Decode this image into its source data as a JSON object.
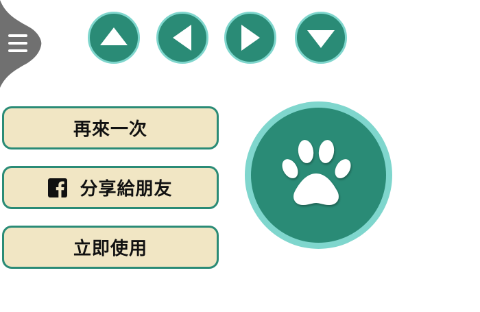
{
  "menu": {
    "icon": "hamburger-icon"
  },
  "nav": {
    "up": {
      "icon": "arrow-up-icon"
    },
    "left": {
      "icon": "arrow-left-icon"
    },
    "right": {
      "icon": "arrow-right-icon"
    },
    "down": {
      "icon": "arrow-down-icon"
    }
  },
  "actions": {
    "retry_label": "再來一次",
    "share_label": "分享給朋友",
    "share_icon": "facebook-icon",
    "use_label": "立即使用"
  },
  "paw": {
    "icon": "paw-icon"
  },
  "colors": {
    "primary": "#2a8b76",
    "ring": "#7fd6cd",
    "button_bg": "#f1e6c4",
    "menu_tab": "#707070"
  }
}
